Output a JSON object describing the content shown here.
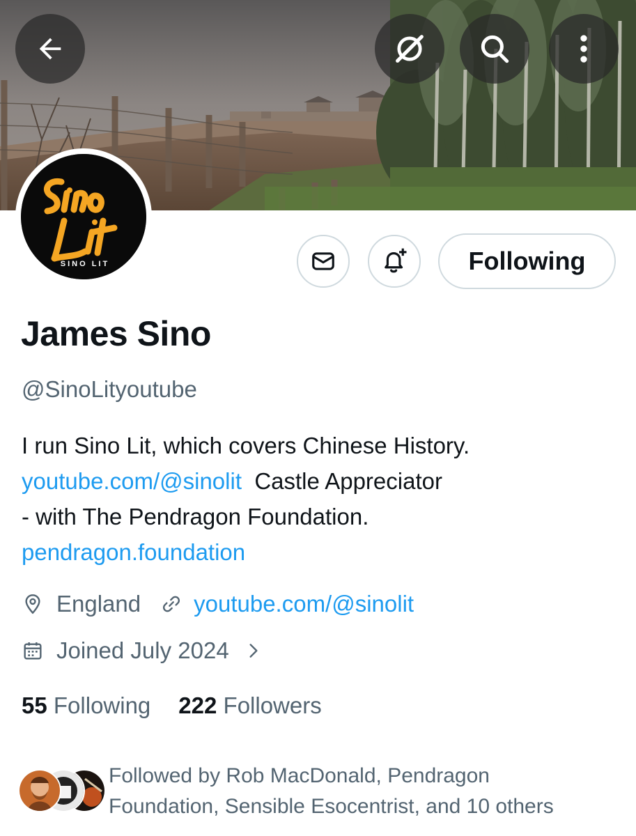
{
  "header": {
    "back_icon": "arrow-left-icon",
    "grok_icon": "grok-icon",
    "search_icon": "search-icon",
    "more_icon": "more-vertical-icon"
  },
  "avatar": {
    "logo_text": "Sino Lit",
    "logo_caption": "SINO LIT"
  },
  "actions": {
    "message_icon": "envelope-icon",
    "notify_icon": "bell-plus-icon",
    "following_label": "Following"
  },
  "profile": {
    "display_name": "James Sino",
    "handle": "@SinoLityoutube",
    "bio": {
      "line1": "I run Sino Lit, which covers Chinese History.",
      "link1": "youtube.com/@sinolit",
      "line2_rest": "Castle Appreciator",
      "line3": "- with The Pendragon Foundation.",
      "link2": "pendragon.foundation"
    },
    "location": "England",
    "website": "youtube.com/@sinolit",
    "joined": "Joined July 2024"
  },
  "stats": {
    "following_count": "55",
    "following_label": "Following",
    "followers_count": "222",
    "followers_label": "Followers"
  },
  "followed_by": {
    "line1": "Followed by Rob MacDonald, Pendragon",
    "line2": "Foundation, Sensible Esocentrist, and 10 others"
  },
  "colors": {
    "accent": "#1d9bf0",
    "text": "#0f1419",
    "muted": "#536471",
    "border": "#cfd9de",
    "logo_gold": "#f5a623"
  }
}
